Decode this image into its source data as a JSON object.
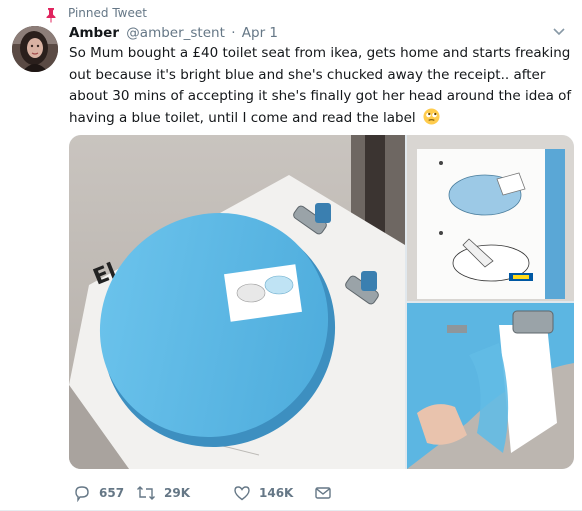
{
  "pinned": {
    "label": "Pinned Tweet"
  },
  "author": {
    "name": "Amber",
    "handle": "@amber_stent",
    "separator": "·",
    "date": "Apr 1"
  },
  "tweet": {
    "text": "So Mum bought a £40 toilet seat from ikea, gets home and starts freaking out because it's bright blue and she's chucked away the receipt.. after about 30 mins of accepting it she's finally got her head around the idea of having a blue toilet, until I come and read the label",
    "emoji": "face-with-rolling-eyes-emoji"
  },
  "media": {
    "photos": [
      {
        "name": "blue-toilet-seat-photo"
      },
      {
        "name": "instruction-label-photo"
      },
      {
        "name": "peeling-film-photo"
      }
    ],
    "package_print": "El"
  },
  "actions": {
    "reply_count": "657",
    "retweet_count": "29K",
    "like_count": "146K"
  },
  "colors": {
    "accent_pin": "#e0245e",
    "text_primary": "#14171a",
    "text_secondary": "#657786",
    "seat_blue": "#5bb8e4"
  }
}
